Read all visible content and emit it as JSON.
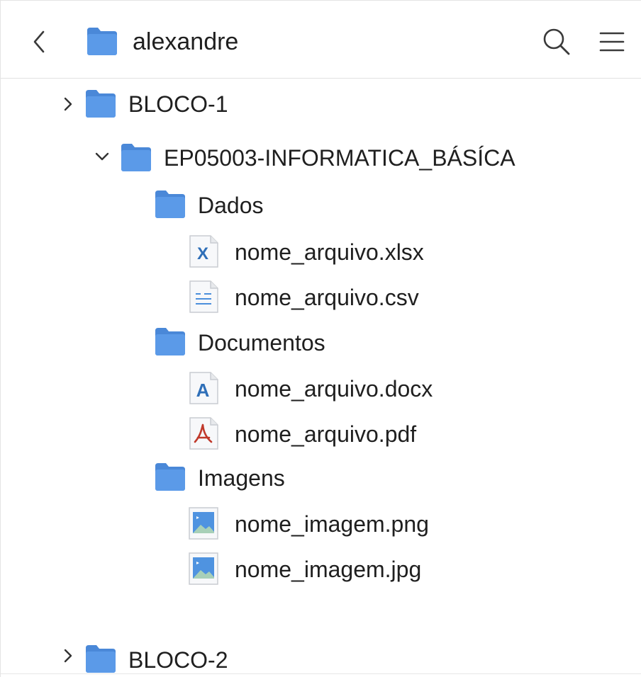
{
  "header": {
    "title": "alexandre",
    "back_icon": "chevron-left-icon",
    "folder_icon": "folder-icon",
    "search_icon": "search-icon",
    "menu_icon": "hamburger-menu-icon"
  },
  "tree": {
    "bloco1": {
      "label": "BLOCO-1",
      "expanded": false
    },
    "course": {
      "label": "EP05003-INFORMATICA_BÁSÍCA",
      "expanded": true
    },
    "dados": {
      "label": "Dados"
    },
    "xlsx": {
      "label": "nome_arquivo.xlsx",
      "icon": "excel-file-icon",
      "glyph": "X"
    },
    "csv": {
      "label": "nome_arquivo.csv",
      "icon": "csv-file-icon"
    },
    "documentos": {
      "label": "Documentos"
    },
    "docx": {
      "label": "nome_arquivo.docx",
      "icon": "word-file-icon",
      "glyph": "A"
    },
    "pdf": {
      "label": "nome_arquivo.pdf",
      "icon": "pdf-file-icon"
    },
    "imagens": {
      "label": "Imagens"
    },
    "png": {
      "label": "nome_imagem.png",
      "icon": "image-file-icon"
    },
    "jpg": {
      "label": "nome_imagem.jpg",
      "icon": "image-file-icon"
    },
    "bloco2": {
      "label": "BLOCO-2",
      "expanded": false
    }
  },
  "colors": {
    "folder": "#5b9ae8",
    "folder_tab": "#4a88d8",
    "xlsx": "#2f6fb8",
    "csv": "#4b8fdc",
    "docx": "#2f6fb8",
    "pdf": "#c0392b",
    "image": "#4f93e0"
  }
}
